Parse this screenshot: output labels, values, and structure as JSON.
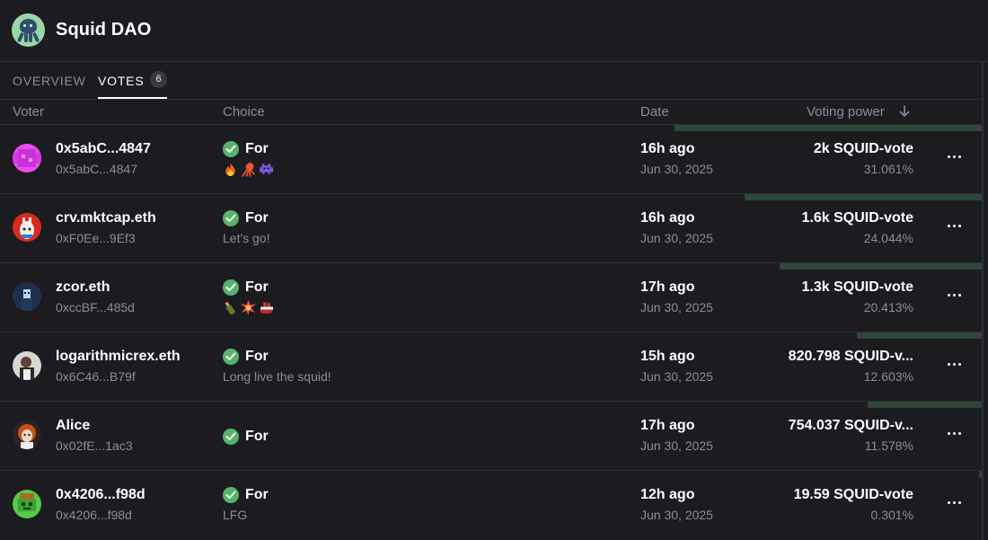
{
  "app": {
    "title": "Squid DAO"
  },
  "tabs": [
    {
      "label": "OVERVIEW"
    },
    {
      "label": "VOTES",
      "badge": "6"
    }
  ],
  "table": {
    "headers": {
      "voter": "Voter",
      "choice": "Choice",
      "date": "Date",
      "power": "Voting power"
    },
    "rows": [
      {
        "name": "0x5abC...4847",
        "address": "0x5abC...4847",
        "choice": "For",
        "reason": "",
        "reason_icons": [
          "fire-icon",
          "squid-icon",
          "alien-monster-icon"
        ],
        "ago": "16h ago",
        "date": "Jun 30, 2025",
        "power": "2k SQUID-vote",
        "percent": "31.061%",
        "share": 0.3106
      },
      {
        "name": "crv.mktcap.eth",
        "address": "0xF0Ee...9Ef3",
        "choice": "For",
        "reason": "Let's go!",
        "reason_icons": [],
        "ago": "16h ago",
        "date": "Jun 30, 2025",
        "power": "1.6k SQUID-vote",
        "percent": "24.044%",
        "share": 0.2404
      },
      {
        "name": "zcor.eth",
        "address": "0xccBF...485d",
        "choice": "For",
        "reason": "",
        "reason_icons": [
          "bottle-icon",
          "explosion-icon",
          "ship-icon"
        ],
        "ago": "17h ago",
        "date": "Jun 30, 2025",
        "power": "1.3k SQUID-vote",
        "percent": "20.413%",
        "share": 0.2041
      },
      {
        "name": "logarithmicrex.eth",
        "address": "0x6C46...B79f",
        "choice": "For",
        "reason": "Long live the squid!",
        "reason_icons": [],
        "ago": "15h ago",
        "date": "Jun 30, 2025",
        "power": "820.798 SQUID-v...",
        "percent": "12.603%",
        "share": 0.126
      },
      {
        "name": "Alice",
        "address": "0x02fE...1ac3",
        "choice": "For",
        "reason": "",
        "reason_icons": [],
        "ago": "17h ago",
        "date": "Jun 30, 2025",
        "power": "754.037 SQUID-v...",
        "percent": "11.578%",
        "share": 0.1158
      },
      {
        "name": "0x4206...f98d",
        "address": "0x4206...f98d",
        "choice": "For",
        "reason": "LFG",
        "reason_icons": [],
        "ago": "12h ago",
        "date": "Jun 30, 2025",
        "power": "19.59 SQUID-vote",
        "percent": "0.301%",
        "share": 0.003
      }
    ]
  },
  "colors": {
    "background": "#1c1b20",
    "for_check": "#57b36a",
    "power_bar": "#2d4738",
    "muted_text": "#8e8c95"
  }
}
